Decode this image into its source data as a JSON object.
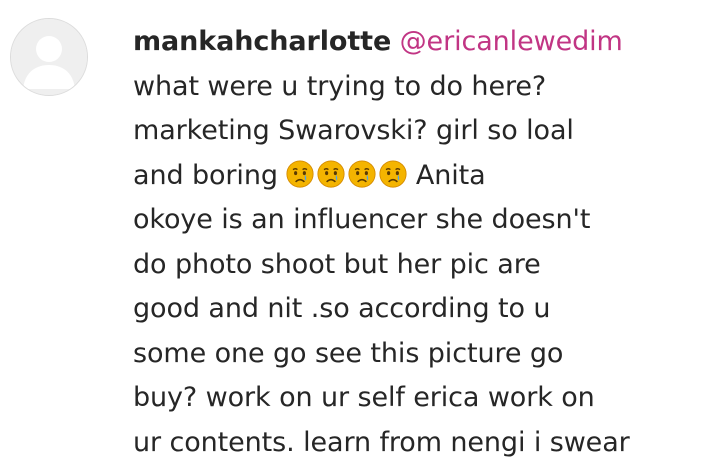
{
  "comment": {
    "username": "mankahcharlotte",
    "mention": "@ericanlewedim",
    "lines": {
      "l1": "what were u trying to do here?",
      "l2": "marketing Swarovski? girl so loal",
      "l3_before": "and boring ",
      "l3_after": " Anita",
      "l4": "okoye is an influencer she doesn't",
      "l5": "do photo shoot but her pic are",
      "l6": "good and nit .so according to u",
      "l7": "some one go see this picture go",
      "l8": "buy? work on ur self erica work on",
      "l9": "ur contents. learn from nengi i swear"
    },
    "emojis": [
      "crying-face-emoji",
      "crying-face-emoji",
      "crying-face-emoji",
      "crying-face-emoji"
    ]
  },
  "colors": {
    "username": "#262626",
    "mention": "#c13584",
    "text": "#262626",
    "avatar_bg": "#efefef"
  }
}
